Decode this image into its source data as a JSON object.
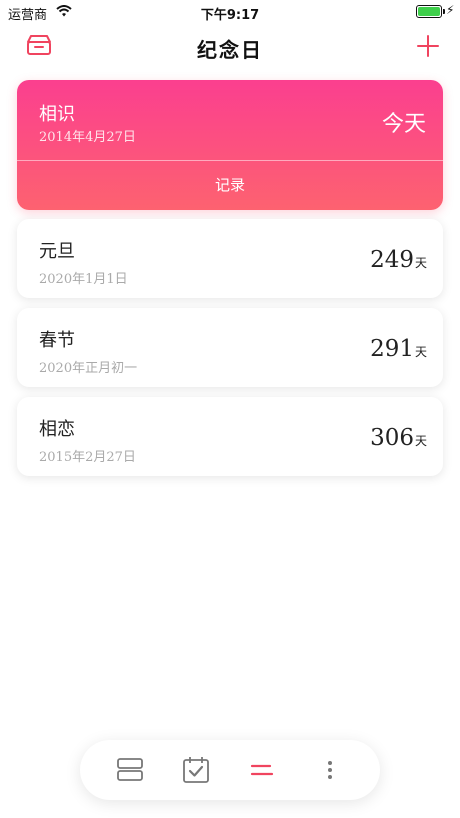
{
  "status_bar": {
    "carrier": "运营商",
    "time": "下午9:17"
  },
  "nav": {
    "title": "纪念日"
  },
  "featured": {
    "name": "相识",
    "date": "2014年4月27日",
    "days_text": "今天",
    "record_label": "记录"
  },
  "events": [
    {
      "name": "元旦",
      "date": "2020年1月1日",
      "days": "249",
      "unit": "天"
    },
    {
      "name": "春节",
      "date": "2020年正月初一",
      "days": "291",
      "unit": "天"
    },
    {
      "name": "相恋",
      "date": "2015年2月27日",
      "days": "306",
      "unit": "天"
    }
  ],
  "colors": {
    "accent": "#f0445f",
    "gradient_top": "#fb3f8f",
    "gradient_bottom": "#fd6270",
    "battery": "#3ecf4b"
  }
}
